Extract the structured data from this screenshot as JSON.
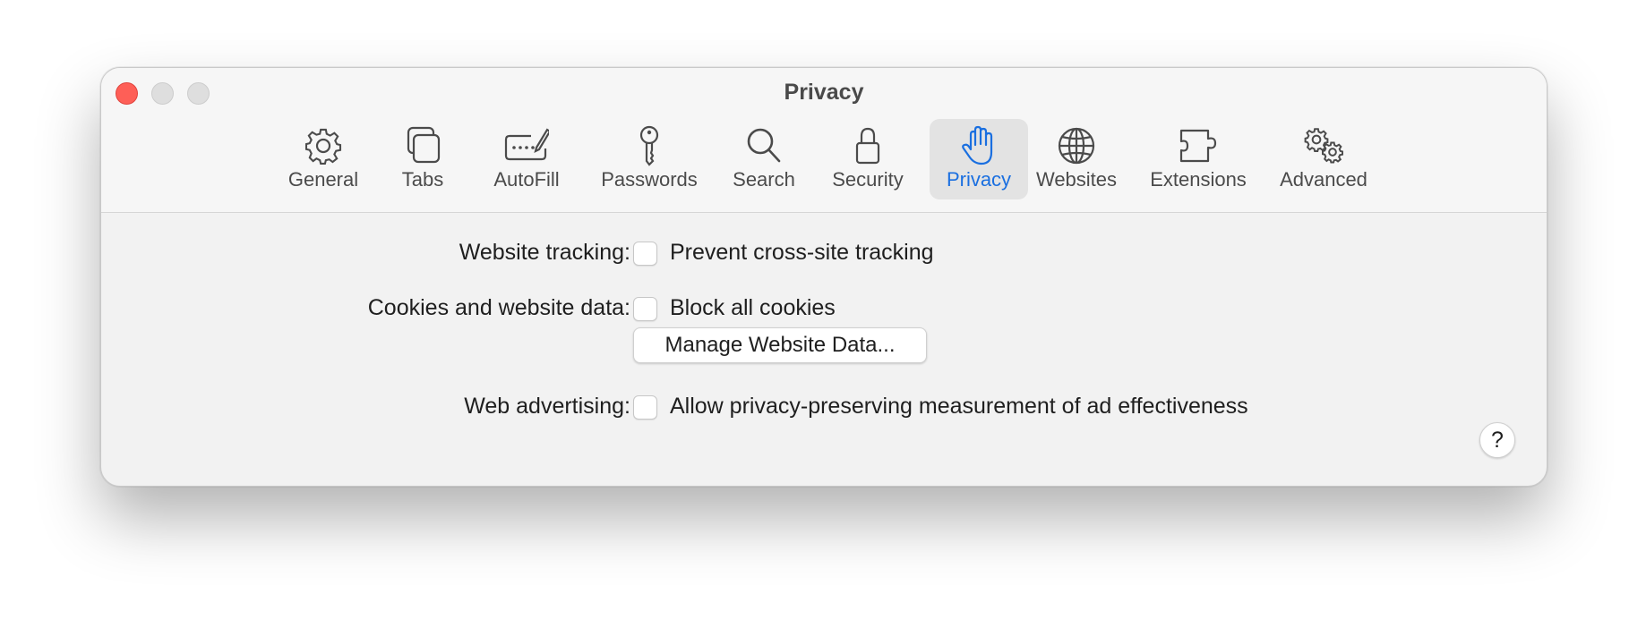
{
  "window": {
    "title": "Privacy",
    "accent_color": "#1a6fe0",
    "close_color": "#fe5f57"
  },
  "toolbar": {
    "selected": "Privacy",
    "items": [
      {
        "label": "General",
        "icon": "gear-icon"
      },
      {
        "label": "Tabs",
        "icon": "tabs-icon"
      },
      {
        "label": "AutoFill",
        "icon": "autofill-icon"
      },
      {
        "label": "Passwords",
        "icon": "key-icon"
      },
      {
        "label": "Search",
        "icon": "search-icon"
      },
      {
        "label": "Security",
        "icon": "lock-icon"
      },
      {
        "label": "Privacy",
        "icon": "hand-icon"
      },
      {
        "label": "Websites",
        "icon": "globe-icon"
      },
      {
        "label": "Extensions",
        "icon": "puzzle-icon"
      },
      {
        "label": "Advanced",
        "icon": "gears-icon"
      }
    ]
  },
  "settings": {
    "tracking": {
      "label": "Website tracking:",
      "option": "Prevent cross-site tracking",
      "checked": false
    },
    "cookies": {
      "label": "Cookies and website data:",
      "option": "Block all cookies",
      "checked": false,
      "button": "Manage Website Data..."
    },
    "advertising": {
      "label": "Web advertising:",
      "option": "Allow privacy-preserving measurement of ad effectiveness",
      "checked": false
    }
  },
  "help": {
    "label": "?"
  }
}
